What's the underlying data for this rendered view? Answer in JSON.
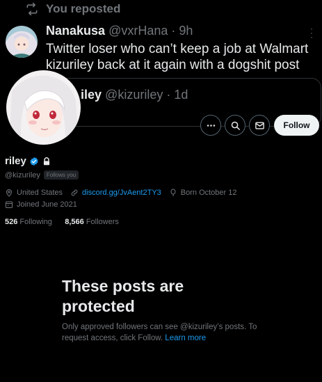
{
  "repost_header": {
    "label": "You reposted"
  },
  "tweet": {
    "author_name": "Nanakusa",
    "author_handle": "@vxrHana",
    "separator": "·",
    "time": "9h",
    "text": "Twitter loser who can’t keep a job at Walmart\nkizuriley back at it again with a dogshit post"
  },
  "quoted": {
    "author_name_fragment": "iley",
    "author_handle": "@kizuriley",
    "separator": "·",
    "time": "1d"
  },
  "profile": {
    "follow_label": "Follow",
    "display_name": "riley",
    "handle": "@kizuriley",
    "follows_you": "Follows you",
    "location": "United States",
    "link": "discord.gg/JvAent2TY3",
    "birthday": "Born October 12",
    "joined": "Joined June 2021",
    "following_count": "526",
    "following_label": "Following",
    "followers_count": "8,566",
    "followers_label": "Followers"
  },
  "protected": {
    "title": "These posts are\nprotected",
    "desc": "Only approved followers can see @kizuriley’s posts. To request access, click Follow.",
    "learn_more": "Learn more"
  },
  "colors": {
    "link": "#1d9bf0",
    "muted": "#71767b",
    "text": "#e7e9ea",
    "background": "#000000"
  }
}
